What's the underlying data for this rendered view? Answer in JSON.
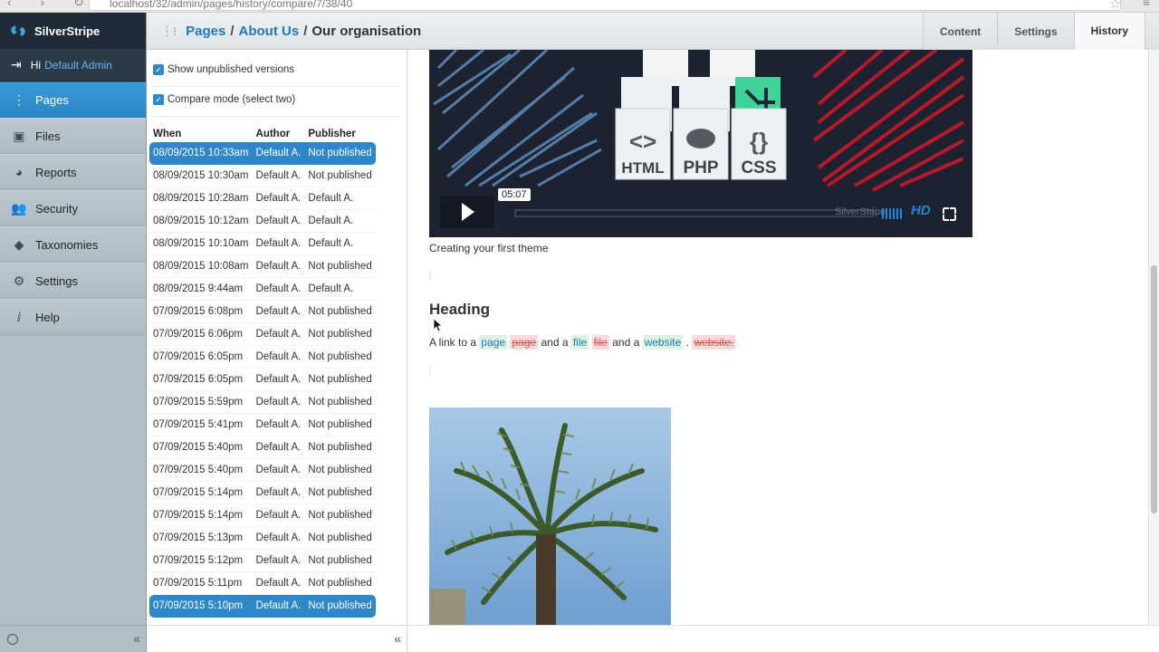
{
  "browser": {
    "url": "localhost/32/admin/pages/history/compare/7/38/40"
  },
  "brand": {
    "name": "SilverStripe"
  },
  "user": {
    "greeting": "Hi",
    "name": "Default Admin"
  },
  "menu": {
    "items": [
      {
        "label": "Pages",
        "icon": "sitemap-icon"
      },
      {
        "label": "Files",
        "icon": "image-icon"
      },
      {
        "label": "Reports",
        "icon": "pie-chart-icon"
      },
      {
        "label": "Security",
        "icon": "users-icon"
      },
      {
        "label": "Taxonomies",
        "icon": "tag-icon"
      },
      {
        "label": "Settings",
        "icon": "gear-icon"
      },
      {
        "label": "Help",
        "icon": "info-icon"
      }
    ],
    "active": "Pages",
    "collapse_symbol": "«"
  },
  "breadcrumbs": {
    "first": "Pages",
    "second": "About Us",
    "current": "Our organisation",
    "separator": "/"
  },
  "tabs": {
    "content": "Content",
    "settings": "Settings",
    "history": "History"
  },
  "versions": {
    "show_unpublished": "Show unpublished versions",
    "compare_mode": "Compare mode (select two)",
    "columns": {
      "when": "When",
      "author": "Author",
      "publisher": "Publisher"
    },
    "rows": [
      {
        "when": "08/09/2015 10:33am",
        "author": "Default A.",
        "publisher": "Not published",
        "selected": true
      },
      {
        "when": "08/09/2015 10:30am",
        "author": "Default A.",
        "publisher": "Not published",
        "selected": false
      },
      {
        "when": "08/09/2015 10:28am",
        "author": "Default A.",
        "publisher": "Default A.",
        "selected": false
      },
      {
        "when": "08/09/2015 10:12am",
        "author": "Default A.",
        "publisher": "Default A.",
        "selected": false
      },
      {
        "when": "08/09/2015 10:10am",
        "author": "Default A.",
        "publisher": "Default A.",
        "selected": false
      },
      {
        "when": "08/09/2015 10:08am",
        "author": "Default A.",
        "publisher": "Not published",
        "selected": false
      },
      {
        "when": "08/09/2015 9:44am",
        "author": "Default A.",
        "publisher": "Default A.",
        "selected": false
      },
      {
        "when": "07/09/2015 6:08pm",
        "author": "Default A.",
        "publisher": "Not published",
        "selected": false
      },
      {
        "when": "07/09/2015 6:06pm",
        "author": "Default A.",
        "publisher": "Not published",
        "selected": false
      },
      {
        "when": "07/09/2015 6:05pm",
        "author": "Default A.",
        "publisher": "Not published",
        "selected": false
      },
      {
        "when": "07/09/2015 6:05pm",
        "author": "Default A.",
        "publisher": "Not published",
        "selected": false
      },
      {
        "when": "07/09/2015 5:59pm",
        "author": "Default A.",
        "publisher": "Not published",
        "selected": false
      },
      {
        "when": "07/09/2015 5:41pm",
        "author": "Default A.",
        "publisher": "Not published",
        "selected": false
      },
      {
        "when": "07/09/2015 5:40pm",
        "author": "Default A.",
        "publisher": "Not published",
        "selected": false
      },
      {
        "when": "07/09/2015 5:40pm",
        "author": "Default A.",
        "publisher": "Not published",
        "selected": false
      },
      {
        "when": "07/09/2015 5:14pm",
        "author": "Default A.",
        "publisher": "Not published",
        "selected": false
      },
      {
        "when": "07/09/2015 5:14pm",
        "author": "Default A.",
        "publisher": "Not published",
        "selected": false
      },
      {
        "when": "07/09/2015 5:13pm",
        "author": "Default A.",
        "publisher": "Not published",
        "selected": false
      },
      {
        "when": "07/09/2015 5:12pm",
        "author": "Default A.",
        "publisher": "Not published",
        "selected": false
      },
      {
        "when": "07/09/2015 5:11pm",
        "author": "Default A.",
        "publisher": "Not published",
        "selected": false
      },
      {
        "when": "07/09/2015 5:10pm",
        "author": "Default A.",
        "publisher": "Not published",
        "selected": true
      }
    ]
  },
  "preview": {
    "video": {
      "timecode": "05:07",
      "hd_label": "HD",
      "watermark": "SilverStripe",
      "file_labels": [
        "HTML",
        "PHP",
        "CSS"
      ]
    },
    "caption": "Creating your first theme",
    "heading": "Heading",
    "paragraph": {
      "prefix": "A link to a",
      "ins1": "page",
      "del1": "page",
      "mid1": "and a",
      "ins2": "file",
      "del2": "file",
      "mid2": "and a",
      "ins3": "website",
      "dot": ".",
      "del3": "website."
    }
  },
  "colors": {
    "accent": "#2d87c8",
    "sidebar": "#b0bec7",
    "brand_bg": "#1f2c37",
    "insert_bg": "#dff2e1",
    "delete_bg": "#fbdadb",
    "delete_text": "#d9534f"
  }
}
